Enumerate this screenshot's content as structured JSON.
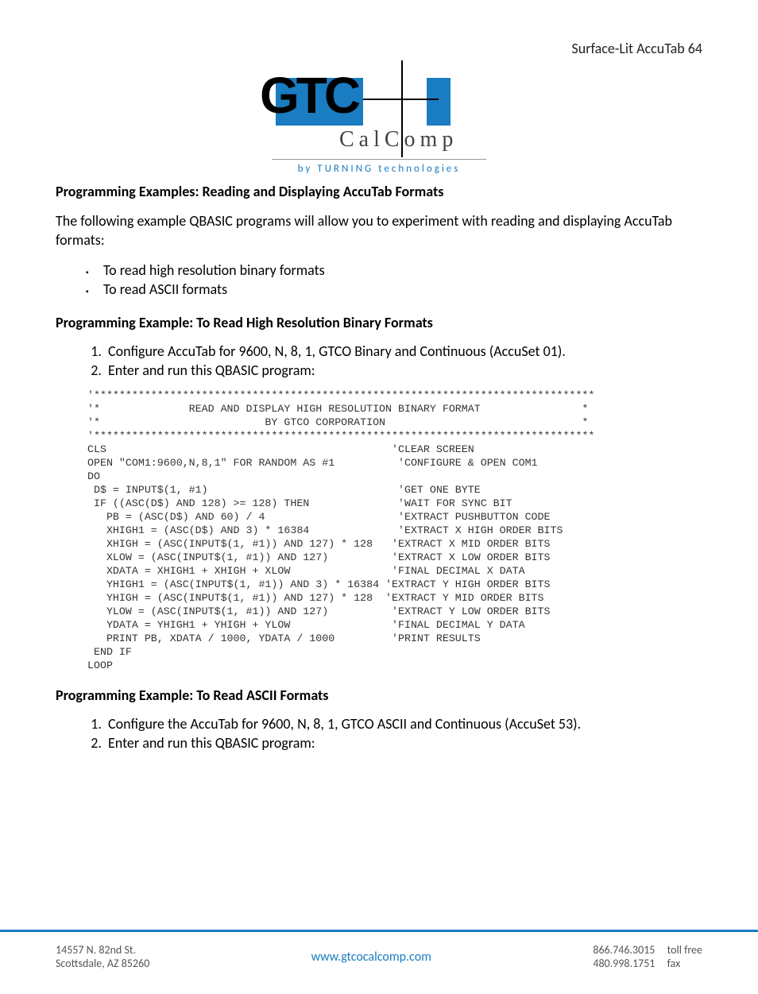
{
  "header": {
    "doc_label": "Surface-Lit AccuTab 64"
  },
  "logo": {
    "gt": "GTC",
    "calcomp": "CalComp",
    "byline": "by TURNING technologies"
  },
  "section1": {
    "heading": "Programming Examples: Reading and Displaying AccuTab Formats",
    "intro": "The following example QBASIC programs will allow you to experiment with reading and displaying AccuTab formats:",
    "bullets": [
      "To read high resolution binary formats",
      "To read ASCII formats"
    ]
  },
  "section2": {
    "heading": "Programming Example: To Read High Resolution Binary Formats",
    "steps": [
      "Configure AccuTab for 9600, N, 8, 1, GTCO Binary and Continuous (AccuSet 01).",
      "Enter and run this QBASIC program:"
    ],
    "code": "'*******************************************************************************\n'*              READ AND DISPLAY HIGH RESOLUTION BINARY FORMAT                *\n'*                          BY GTCO CORPORATION                               *\n'*******************************************************************************\nCLS                                             'CLEAR SCREEN\nOPEN \"COM1:9600,N,8,1\" FOR RANDOM AS #1          'CONFIGURE & OPEN COM1\nDO\n D$ = INPUT$(1, #1)                              'GET ONE BYTE\n IF ((ASC(D$) AND 128) >= 128) THEN              'WAIT FOR SYNC BIT\n   PB = (ASC(D$) AND 60) / 4                     'EXTRACT PUSHBUTTON CODE\n   XHIGH1 = (ASC(D$) AND 3) * 16384              'EXTRACT X HIGH ORDER BITS\n   XHIGH = (ASC(INPUT$(1, #1)) AND 127) * 128   'EXTRACT X MID ORDER BITS\n   XLOW = (ASC(INPUT$(1, #1)) AND 127)          'EXTRACT X LOW ORDER BITS\n   XDATA = XHIGH1 + XHIGH + XLOW                'FINAL DECIMAL X DATA\n   YHIGH1 = (ASC(INPUT$(1, #1)) AND 3) * 16384 'EXTRACT Y HIGH ORDER BITS\n   YHIGH = (ASC(INPUT$(1, #1)) AND 127) * 128  'EXTRACT Y MID ORDER BITS\n   YLOW = (ASC(INPUT$(1, #1)) AND 127)          'EXTRACT Y LOW ORDER BITS\n   YDATA = YHIGH1 + YHIGH + YLOW                'FINAL DECIMAL Y DATA\n   PRINT PB, XDATA / 1000, YDATA / 1000         'PRINT RESULTS\n END IF\nLOOP"
  },
  "section3": {
    "heading": "Programming Example: To Read ASCII Formats",
    "steps": [
      "Configure the AccuTab for 9600, N, 8, 1, GTCO ASCII and Continuous (AccuSet 53).",
      "Enter and run this QBASIC program:"
    ]
  },
  "footer": {
    "addr1": "14557 N. 82nd St.",
    "addr2": "Scottsdale, AZ 85260",
    "url": "www.gtcocalcomp.com",
    "phone1": "866.746.3015",
    "phone1_lbl": "toll free",
    "phone2": "480.998.1751",
    "phone2_lbl": "fax"
  }
}
